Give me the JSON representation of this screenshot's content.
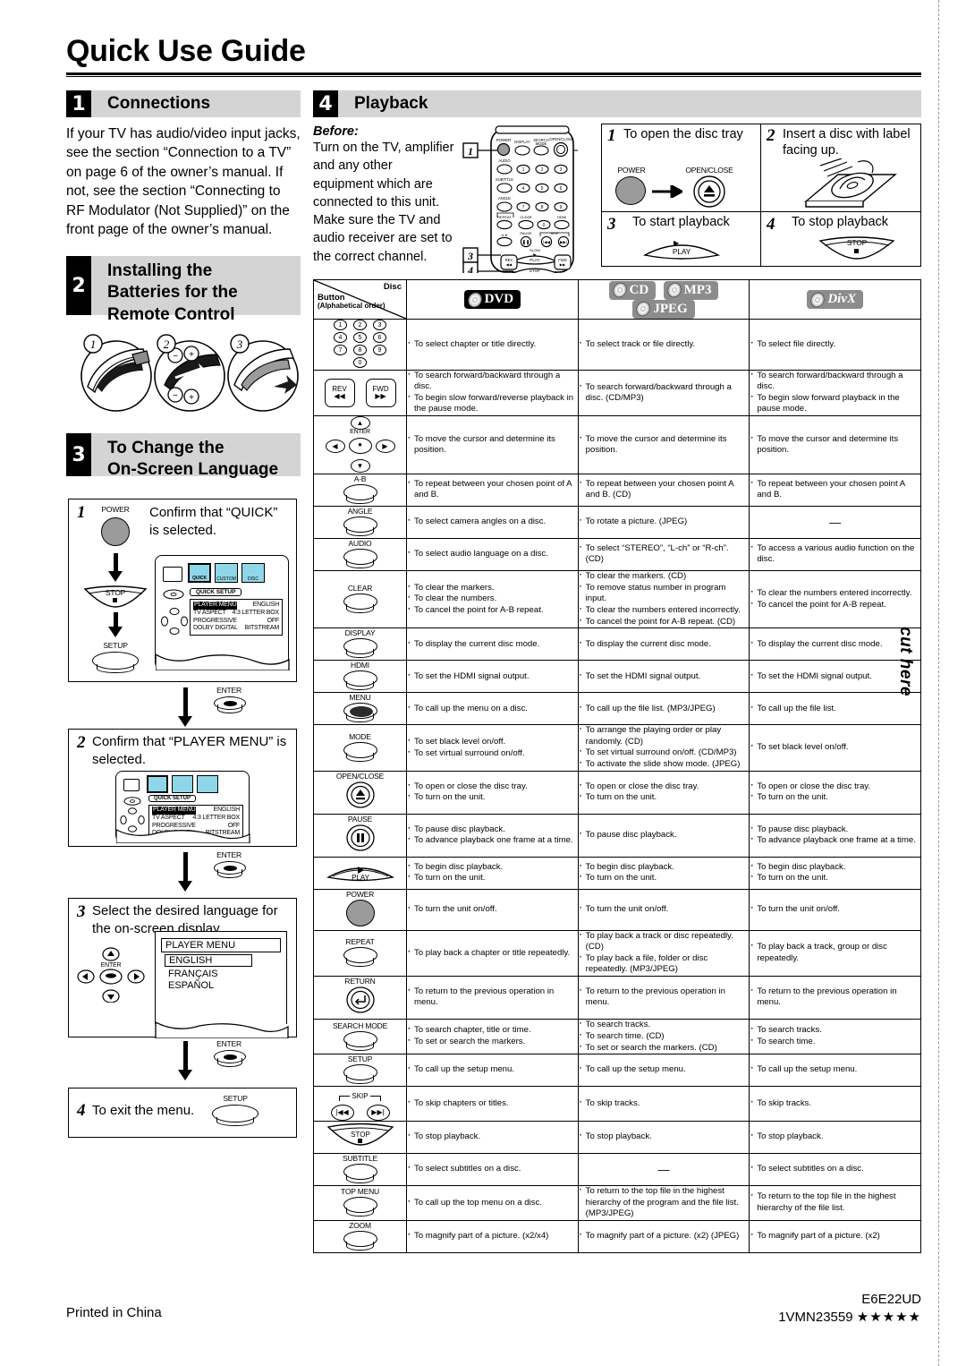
{
  "page": {
    "title": "Quick Use Guide",
    "cut_label": "cut here"
  },
  "sections": {
    "connections": {
      "number": "1",
      "heading": "Connections",
      "body": "If your TV has audio/video input jacks, see the section “Connection to a TV” on page 6 of the owner’s manual. If not, see the section “Connecting to RF Modulator (Not Supplied)” on the front page of the owner’s manual."
    },
    "batteries": {
      "number": "2",
      "heading_line1": "Installing the",
      "heading_line2": "Batteries for the",
      "heading_line3": "Remote Control",
      "figures": [
        "1",
        "2",
        "3"
      ]
    },
    "language": {
      "number": "3",
      "heading_line1": "To Change the",
      "heading_line2": "On-Screen Language",
      "step1": {
        "num": "1",
        "text": "Confirm that “QUICK” is selected.",
        "buttons": [
          "POWER",
          "STOP",
          "SETUP"
        ],
        "osd_title": "QUICK SETUP",
        "osd_rows": [
          {
            "label": "PLAYER MENU",
            "value": "ENGLISH"
          },
          {
            "label": "TV ASPECT",
            "value": "4:3 LETTER BOX"
          },
          {
            "label": "PROGRESSIVE",
            "value": "OFF"
          },
          {
            "label": "DOLBY DIGITAL",
            "value": "BITSTREAM"
          }
        ],
        "tabs": [
          "QUICK",
          "CUSTOM",
          "DISC\nLANG."
        ]
      },
      "connector1": "ENTER",
      "step2": {
        "num": "2",
        "text": "Confirm that “PLAYER MENU” is selected.",
        "osd_title": "QUICK SETUP",
        "osd_rows": [
          {
            "label": "PLAYER MENU",
            "value": "ENGLISH"
          },
          {
            "label": "TV ASPECT",
            "value": "4:3 LETTER BOX"
          },
          {
            "label": "PROGRESSIVE",
            "value": "OFF"
          },
          {
            "label": "DOLBY DIGITAL",
            "value": "BITSTREAM"
          }
        ]
      },
      "connector2": "ENTER",
      "step3": {
        "num": "3",
        "text": "Select the desired language for the on-screen display.",
        "menu_title": "PLAYER MENU",
        "menu_items": [
          "ENGLISH",
          "FRANÇAIS",
          "ESPAÑOL"
        ],
        "enter_label": "ENTER"
      },
      "connector3": "ENTER",
      "step4": {
        "num": "4",
        "text": "To exit the menu.",
        "button": "SETUP"
      }
    },
    "playback": {
      "number": "4",
      "heading": "Playback",
      "before_label": "Before:",
      "before_text": "Turn on the TV, amplifier and any other equipment which are connected to this unit. Make sure the TV and audio receiver are set to the correct channel.",
      "callouts": [
        "1",
        "3",
        "4"
      ],
      "remote_labels": [
        "POWER",
        "DISPLAY",
        "SEARCH MODE",
        "OPEN/CLOSE",
        "AUDIO",
        "SUBTITLE",
        "ANGLE",
        "REPEAT",
        "CLEAR",
        "HDMI",
        "A-B",
        "PAUSE",
        "SKIP",
        "SLOW",
        "PLAY",
        "REV",
        "FWD",
        "STOP"
      ],
      "steps": [
        {
          "num": "1",
          "text": "To open the disc tray",
          "btn_a": "POWER",
          "btn_b": "OPEN/CLOSE"
        },
        {
          "num": "2",
          "text": "Insert a disc with label facing up."
        },
        {
          "num": "3",
          "text": "To start playback",
          "btn": "PLAY"
        },
        {
          "num": "4",
          "text": "To stop playback",
          "btn": "STOP"
        }
      ]
    }
  },
  "table": {
    "corner": {
      "disc_word": "Disc",
      "button_word": "Button",
      "button_sub": "(Alphabetical order)"
    },
    "columns": [
      {
        "id": "dvd",
        "badges": [
          {
            "text": "DVD",
            "style": "black"
          }
        ]
      },
      {
        "id": "cd_mp3_jpeg",
        "badges": [
          {
            "text": "CD",
            "style": "gray"
          },
          {
            "text": "MP3",
            "style": "gray"
          },
          {
            "text": "JPEG",
            "style": "gray"
          }
        ]
      },
      {
        "id": "divx",
        "badges": [
          {
            "text": "DivX",
            "style": "gray-divx"
          }
        ]
      }
    ],
    "rows": [
      {
        "button": "numbers",
        "button_label": "",
        "dvd": [
          "To select chapter or title directly."
        ],
        "cd": [
          "To select track or file directly."
        ],
        "divx": [
          "To select file directly."
        ]
      },
      {
        "button": "rev-fwd",
        "button_label": "REV / FWD",
        "dvd": [
          "To search forward/backward through a disc.",
          "To begin slow forward/reverse playback in the pause mode."
        ],
        "cd": [
          "To search forward/backward through a disc. (CD/MP3)"
        ],
        "divx": [
          "To search forward/backward through a disc.",
          "To begin slow forward playback in the pause mode."
        ]
      },
      {
        "button": "cursor",
        "button_label": "ENTER",
        "dvd": [
          "To move the cursor and determine its position."
        ],
        "cd": [
          "To move the cursor and determine its position."
        ],
        "divx": [
          "To move the cursor and determine its position."
        ]
      },
      {
        "button": "oval",
        "button_label": "A-B",
        "dvd": [
          "To repeat between your chosen point of A and B."
        ],
        "cd": [
          "To repeat between your chosen point A and B. (CD)"
        ],
        "divx": [
          "To repeat between your chosen point A and B."
        ]
      },
      {
        "button": "oval",
        "button_label": "ANGLE",
        "dvd": [
          "To select camera angles on a disc."
        ],
        "cd": [
          "To rotate a picture. (JPEG)"
        ],
        "divx": "—"
      },
      {
        "button": "oval",
        "button_label": "AUDIO",
        "dvd": [
          "To select audio language on a disc."
        ],
        "cd": [
          "To select “STEREO”, “L-ch” or “R-ch”. (CD)"
        ],
        "divx": [
          "To access a various audio function on the disc."
        ]
      },
      {
        "button": "oval",
        "button_label": "CLEAR",
        "dvd": [
          "To clear the markers.",
          "To clear the numbers.",
          "To cancel the point for A-B repeat."
        ],
        "cd": [
          "To clear the markers. (CD)",
          "To remove status number in program input.",
          "To clear the numbers entered incorrectly.",
          "To cancel the point for A-B repeat. (CD)"
        ],
        "divx": [
          "To clear the numbers entered incorrectly.",
          "To cancel the point for A-B repeat."
        ]
      },
      {
        "button": "oval",
        "button_label": "DISPLAY",
        "dvd": [
          "To display the current disc mode."
        ],
        "cd": [
          "To display the current disc mode."
        ],
        "divx": [
          "To display the current disc mode."
        ]
      },
      {
        "button": "oval",
        "button_label": "HDMI",
        "dvd": [
          "To set the HDMI signal output."
        ],
        "cd": [
          "To set the HDMI signal output."
        ],
        "divx": [
          "To set the HDMI signal output."
        ]
      },
      {
        "button": "oval-filled",
        "button_label": "MENU",
        "dvd": [
          "To call up the menu on a disc."
        ],
        "cd": [
          "To call up the file list. (MP3/JPEG)"
        ],
        "divx": [
          "To call up the file list."
        ]
      },
      {
        "button": "oval",
        "button_label": "MODE",
        "dvd": [
          "To set black level on/off.",
          "To set virtual surround on/off."
        ],
        "cd": [
          "To arrange the playing order or play randomly. (CD)",
          "To set virtual surround on/off. (CD/MP3)",
          "To activate the slide show mode. (JPEG)"
        ],
        "divx": [
          "To set black level on/off."
        ]
      },
      {
        "button": "round-eject",
        "button_label": "OPEN/CLOSE",
        "dvd": [
          "To open or close the disc tray.",
          "To turn on the unit."
        ],
        "cd": [
          "To open or close the disc tray.",
          "To turn on the unit."
        ],
        "divx": [
          "To open or close the disc tray.",
          "To turn on the unit."
        ]
      },
      {
        "button": "round-pause",
        "button_label": "PAUSE",
        "dvd": [
          "To pause disc playback.",
          "To advance playback one frame at a time."
        ],
        "cd": [
          "To pause disc playback."
        ],
        "divx": [
          "To pause disc playback.",
          "To advance playback one frame at a time."
        ]
      },
      {
        "button": "trap-play",
        "button_label": "PLAY",
        "dvd": [
          "To begin disc playback.",
          "To turn on the unit."
        ],
        "cd": [
          "To begin disc playback.",
          "To turn on the unit."
        ],
        "divx": [
          "To begin disc playback.",
          "To turn on the unit."
        ]
      },
      {
        "button": "gray-round",
        "button_label": "POWER",
        "dvd": [
          "To turn the unit on/off."
        ],
        "cd": [
          "To turn the unit on/off."
        ],
        "divx": [
          "To turn the unit on/off."
        ]
      },
      {
        "button": "oval",
        "button_label": "REPEAT",
        "dvd": [
          "To play back a chapter or title repeatedly."
        ],
        "cd": [
          "To play back a track or disc repeatedly. (CD)",
          "To play back a file, folder or disc repeatedly. (MP3/JPEG)"
        ],
        "divx": [
          "To play back a track, group or disc repeatedly."
        ]
      },
      {
        "button": "round-return",
        "button_label": "RETURN",
        "dvd": [
          "To return to the previous operation in menu."
        ],
        "cd": [
          "To return to the previous operation in menu."
        ],
        "divx": [
          "To return to the previous operation in menu."
        ]
      },
      {
        "button": "oval",
        "button_label": "SEARCH MODE",
        "dvd": [
          "To search chapter, title or time.",
          "To set or search the markers."
        ],
        "cd": [
          "To search tracks.",
          "To search time. (CD)",
          "To set or search the markers. (CD)"
        ],
        "divx": [
          "To search tracks.",
          "To search time."
        ]
      },
      {
        "button": "oval",
        "button_label": "SETUP",
        "dvd": [
          "To call up the setup menu."
        ],
        "cd": [
          "To call up the setup menu."
        ],
        "divx": [
          "To call up the setup menu."
        ]
      },
      {
        "button": "skip",
        "button_label": "SKIP",
        "dvd": [
          "To skip chapters or titles."
        ],
        "cd": [
          "To skip tracks."
        ],
        "divx": [
          "To skip tracks."
        ]
      },
      {
        "button": "trap-stop",
        "button_label": "STOP",
        "dvd": [
          "To stop playback."
        ],
        "cd": [
          "To stop playback."
        ],
        "divx": [
          "To stop playback."
        ]
      },
      {
        "button": "oval",
        "button_label": "SUBTITLE",
        "dvd": [
          "To select subtitles on a disc."
        ],
        "cd": "—",
        "divx": [
          "To select subtitles on a disc."
        ]
      },
      {
        "button": "oval",
        "button_label": "TOP MENU",
        "dvd": [
          "To call up the top menu on a disc."
        ],
        "cd": [
          "To return to the top file in the highest hierarchy of the program and the file list. (MP3/JPEG)"
        ],
        "divx": [
          "To return to the top file in the highest hierarchy of the file list."
        ]
      },
      {
        "button": "oval",
        "button_label": "ZOOM",
        "dvd": [
          "To magnify part of a picture. (x2/x4)"
        ],
        "cd": [
          "To magnify part of a picture. (x2) (JPEG)"
        ],
        "divx": [
          "To magnify part of a picture. (x2)"
        ]
      }
    ]
  },
  "footer": {
    "printed": "Printed in China",
    "model": "E6E22UD",
    "code": "1VMN23559",
    "stars": "★★★★★"
  }
}
